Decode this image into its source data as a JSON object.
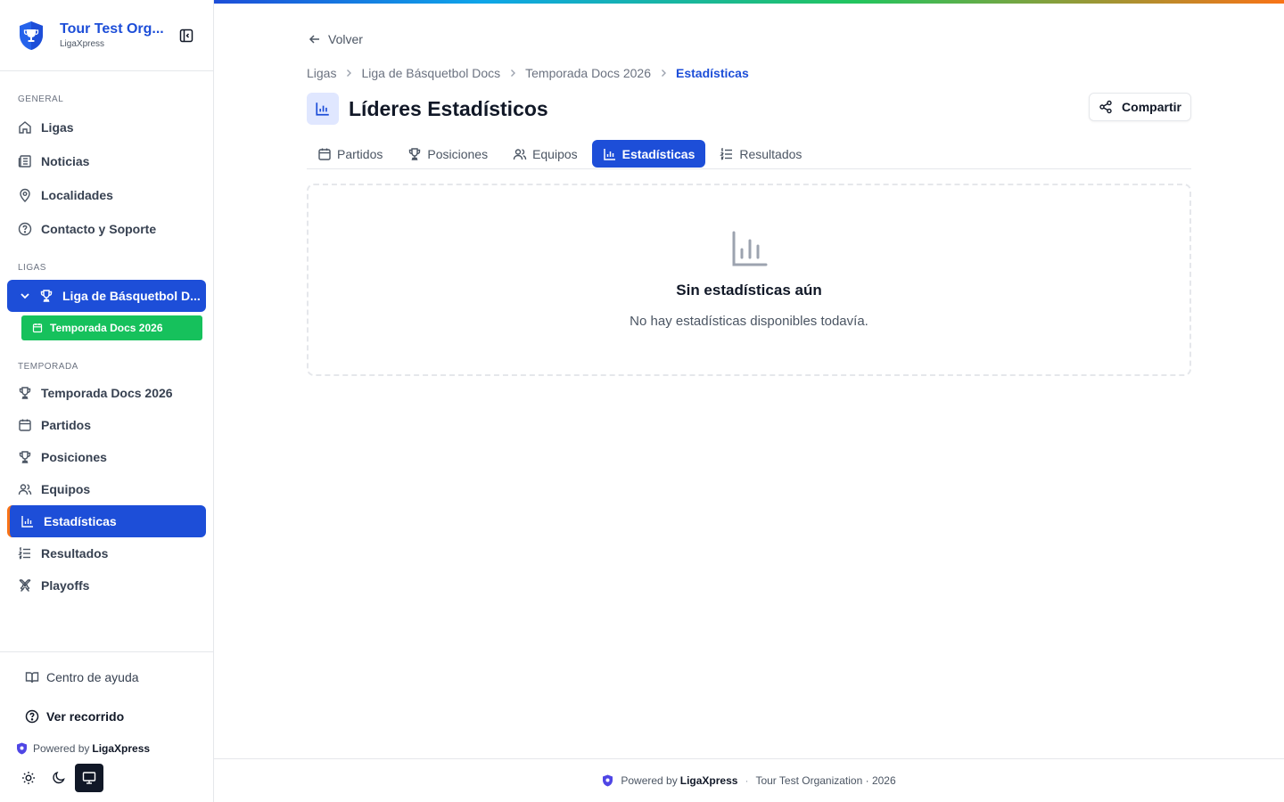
{
  "sidebar": {
    "brand": {
      "title": "Tour Test Org...",
      "subtitle": "LigaXpress"
    },
    "sections": {
      "general": "GENERAL",
      "ligas": "LIGAS",
      "temporada": "TEMPORADA"
    },
    "general_items": [
      {
        "label": "Ligas",
        "icon": "home-icon"
      },
      {
        "label": "Noticias",
        "icon": "newspaper-icon"
      },
      {
        "label": "Localidades",
        "icon": "map-pin-icon"
      },
      {
        "label": "Contacto y Soporte",
        "icon": "help-circle-icon"
      }
    ],
    "league": {
      "label": "Liga de Básquetbol D...",
      "season": "Temporada Docs 2026"
    },
    "season_items": [
      {
        "label": "Temporada Docs 2026",
        "icon": "trophy-icon"
      },
      {
        "label": "Partidos",
        "icon": "calendar-icon"
      },
      {
        "label": "Posiciones",
        "icon": "trophy-icon"
      },
      {
        "label": "Equipos",
        "icon": "users-icon"
      },
      {
        "label": "Estadísticas",
        "icon": "bar-chart-icon",
        "active": true
      },
      {
        "label": "Resultados",
        "icon": "list-ordered-icon"
      },
      {
        "label": "Playoffs",
        "icon": "swords-icon"
      }
    ],
    "bottom": {
      "help": "Centro de ayuda",
      "tour": "Ver recorrido",
      "powered_prefix": "Powered by",
      "powered_brand": "LigaXpress"
    }
  },
  "main": {
    "back_label": "Volver",
    "breadcrumb": [
      "Ligas",
      "Liga de Básquetbol Docs",
      "Temporada Docs 2026",
      "Estadísticas"
    ],
    "title": "Líderes Estadísticos",
    "share_label": "Compartir",
    "tabs": [
      {
        "label": "Partidos",
        "icon": "calendar-icon"
      },
      {
        "label": "Posiciones",
        "icon": "trophy-icon"
      },
      {
        "label": "Equipos",
        "icon": "users-icon"
      },
      {
        "label": "Estadísticas",
        "icon": "bar-chart-icon",
        "active": true
      },
      {
        "label": "Resultados",
        "icon": "list-ordered-icon"
      }
    ],
    "empty": {
      "title": "Sin estadísticas aún",
      "description": "No hay estadísticas disponibles todavía."
    }
  },
  "footer": {
    "powered_prefix": "Powered by",
    "powered_brand": "LigaXpress",
    "org": "Tour Test Organization · 2026"
  },
  "colors": {
    "primary": "#1d4ed8",
    "season_green": "#16c15c",
    "accent_orange": "#f97316"
  }
}
